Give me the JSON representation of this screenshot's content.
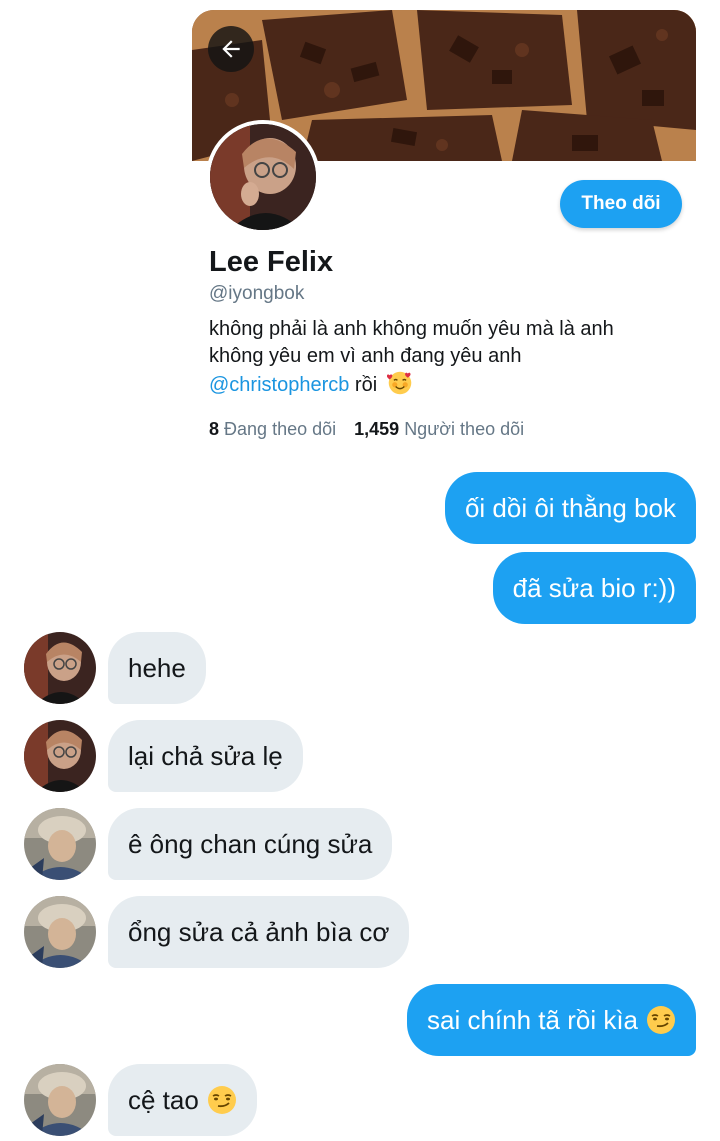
{
  "profile": {
    "back_icon": "arrow-left-icon",
    "name": "Lee Felix",
    "handle": "@iyongbok",
    "follow_label": "Theo dõi",
    "bio_line1": "không phải là anh không muốn yêu mà là anh",
    "bio_line2": "không yêu em vì anh đang yêu anh",
    "bio_mention": "@christophercb",
    "bio_tail": " rồi",
    "bio_emoji": "smiling-face-with-hearts",
    "following_count": "8",
    "following_label": "Đang theo dõi",
    "followers_count": "1,459",
    "followers_label": "Người theo dõi"
  },
  "messages": [
    {
      "side": "sent",
      "text": "ối dồi ôi thằng bok"
    },
    {
      "side": "sent",
      "text": "đã sửa bio r:))"
    },
    {
      "side": "recv",
      "text": "hehe",
      "avatar": "felix-avatar"
    },
    {
      "side": "recv",
      "text": "lại chả sửa lẹ",
      "avatar": "felix-avatar"
    },
    {
      "side": "recv",
      "text": "ê ông chan cúng sửa",
      "avatar": "friend-avatar"
    },
    {
      "side": "recv",
      "text": "ổng sửa cả ảnh bìa cơ",
      "avatar": "friend-avatar"
    },
    {
      "side": "sent",
      "text": "sai chính tã rồi kìa",
      "emoji": "smirking-face"
    },
    {
      "side": "recv",
      "text": "cệ tao",
      "emoji": "smirking-face",
      "avatar": "friend-avatar"
    }
  ],
  "colors": {
    "accent": "#1da1f2",
    "mention": "#1b95e0",
    "received_bubble": "#e6ecf0",
    "secondary_text": "#657786"
  }
}
